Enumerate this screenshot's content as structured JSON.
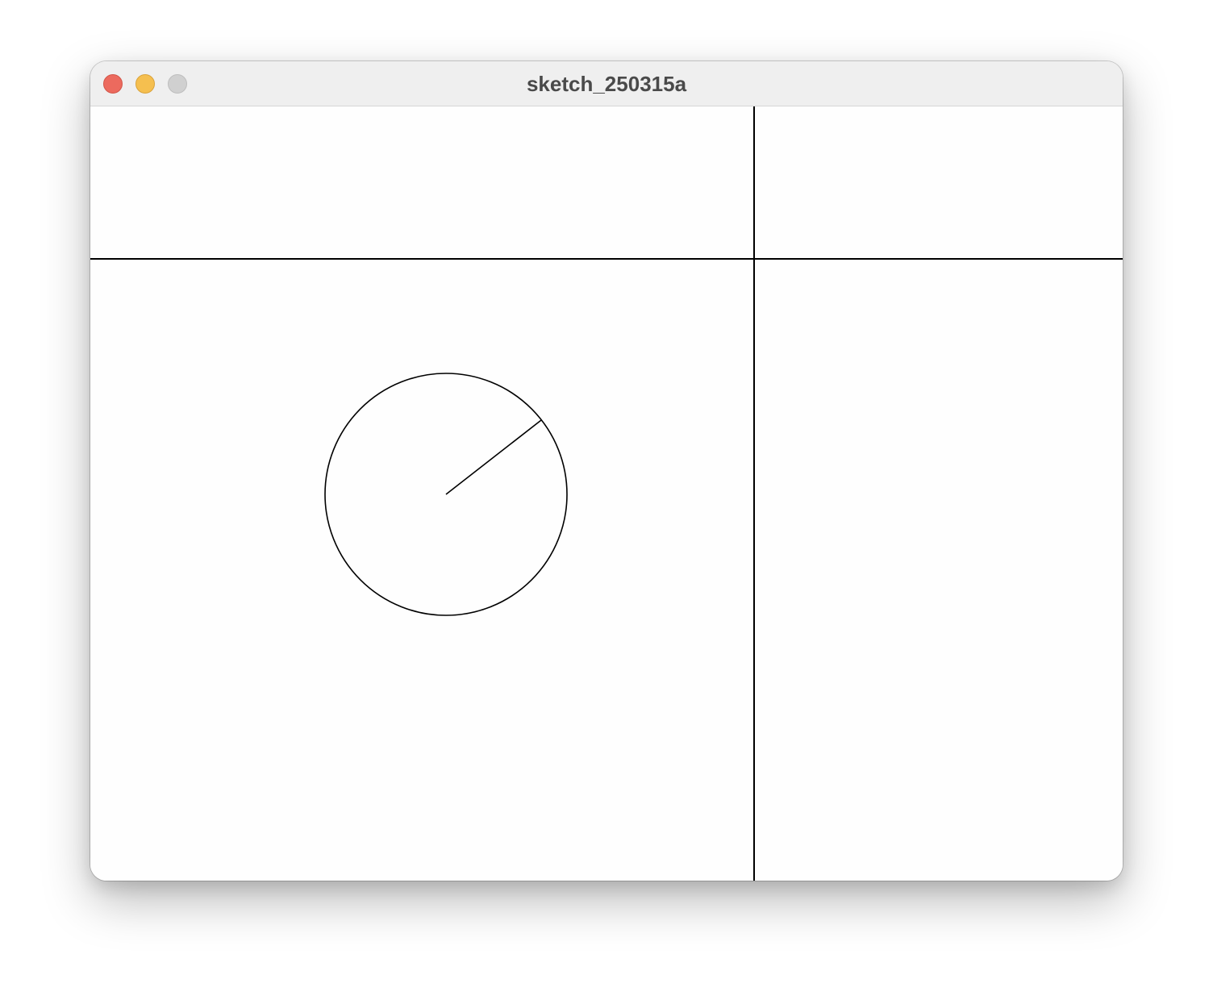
{
  "window": {
    "title": "sketch_250315a"
  },
  "titlebar": {
    "buttons": [
      {
        "name": "close",
        "color": "#ec6a5e"
      },
      {
        "name": "minimize",
        "color": "#f5bf4f"
      },
      {
        "name": "zoom",
        "color": "#d0d0d0"
      }
    ]
  },
  "sketch": {
    "background": "#fefefe",
    "stroke": "#000000",
    "shapes": [
      "vertical-divider-line",
      "horizontal-divider-line",
      "circle",
      "radius-line"
    ]
  }
}
